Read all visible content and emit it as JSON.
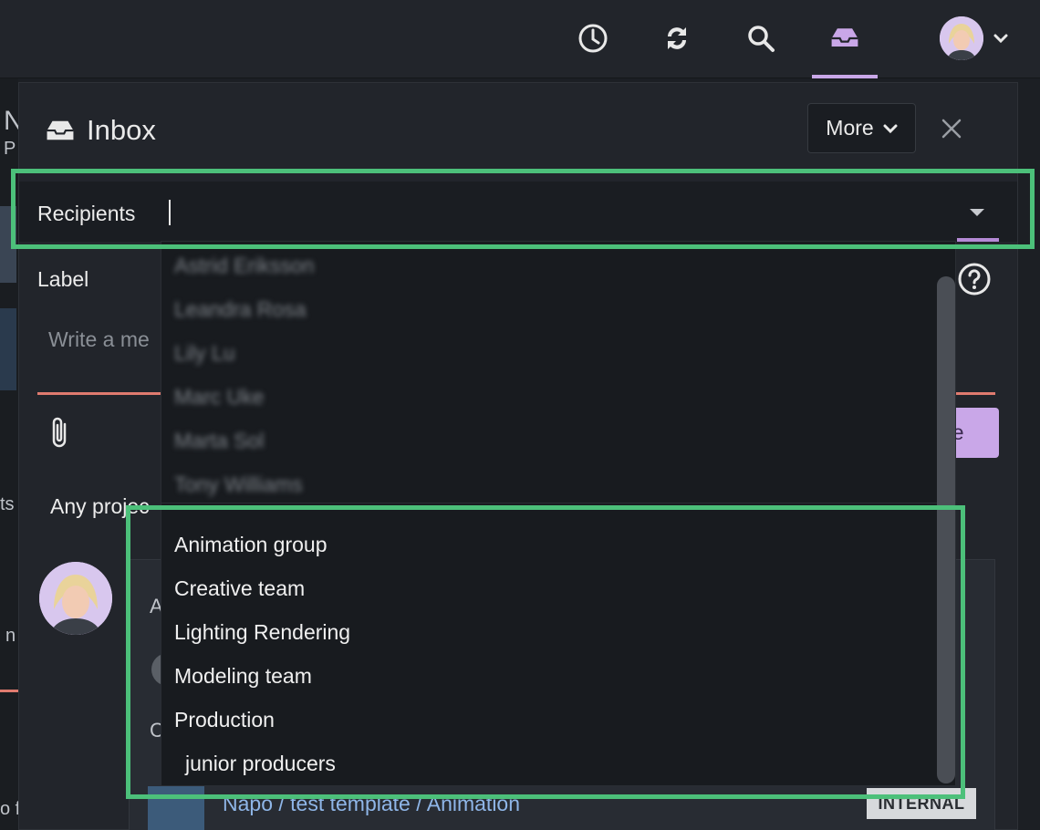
{
  "topbar": {
    "icons": [
      "clock-icon",
      "sync-icon",
      "search-icon",
      "inbox-icon"
    ],
    "active": "inbox",
    "accent": "#c9a7e8"
  },
  "panel": {
    "title": "Inbox",
    "more_label": "More",
    "recipients_label": "Recipients",
    "recipients_value": "",
    "label_label": "Label",
    "message_placeholder": "Write a me",
    "send_label": "ge",
    "filter_label": "Any projec"
  },
  "dropdown": {
    "users": [
      "Astrid Eriksson",
      "Leandra Rosa",
      "Lily Lu",
      "Marc Uke",
      "Marta Sol",
      "Tony Williams"
    ],
    "groups": [
      {
        "label": "Animation group"
      },
      {
        "label": "Creative team"
      },
      {
        "label": "Lighting Rendering"
      },
      {
        "label": "Modeling team"
      },
      {
        "label": "Production"
      },
      {
        "label": "junior producers",
        "sub": true
      }
    ]
  },
  "feed": {
    "letter_a": "A",
    "letter_c": "C",
    "link": "Napo / test template / Animation",
    "badge": "INTERNAL"
  },
  "background": {
    "left_letters": [
      "N",
      "P",
      "ts",
      "n",
      "o f"
    ]
  },
  "colors": {
    "highlight": "#4cc07a",
    "error_line": "#e07b6f",
    "link": "#8fb6e8"
  }
}
